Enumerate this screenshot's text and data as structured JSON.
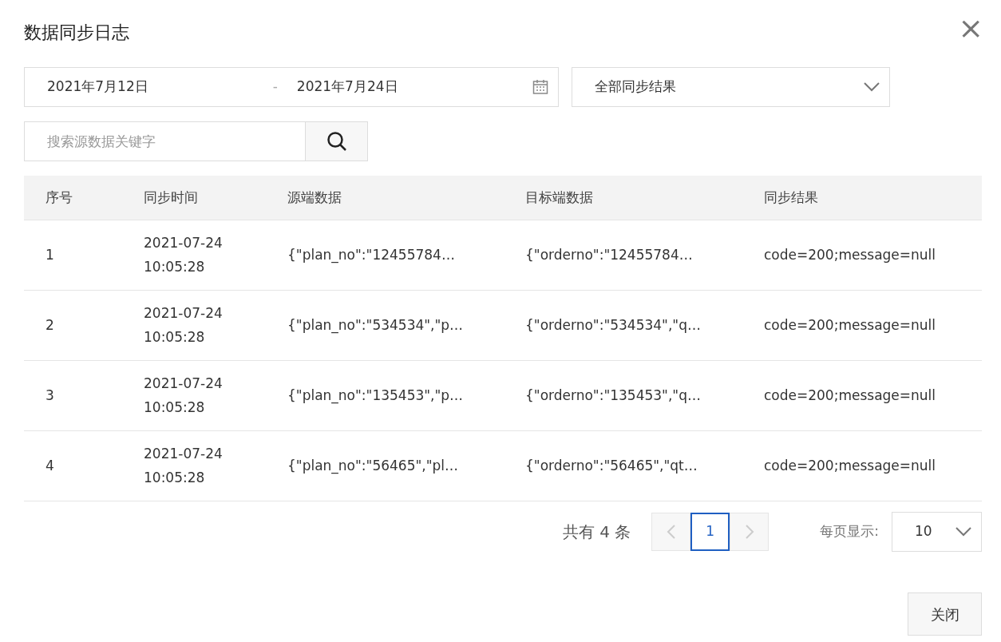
{
  "dialog": {
    "title": "数据同步日志",
    "close_icon": "×"
  },
  "filters": {
    "date_start": "2021年7月12日",
    "date_separator": "-",
    "date_end": "2021年7月24日",
    "result_select": "全部同步结果",
    "search": {
      "placeholder": "搜索源数据关键字"
    }
  },
  "table": {
    "columns": [
      "序号",
      "同步时间",
      "源端数据",
      "目标端数据",
      "同步结果"
    ],
    "rows": [
      {
        "cells": [
          "1",
          "2021-07-24\n10:05:28",
          "{\"plan_no\":\"12455784…",
          "{\"orderno\":\"12455784…",
          "code=200;message=null"
        ]
      },
      {
        "cells": [
          "2",
          "2021-07-24\n10:05:28",
          "{\"plan_no\":\"534534\",\"p…",
          "{\"orderno\":\"534534\",\"q…",
          "code=200;message=null"
        ]
      },
      {
        "cells": [
          "3",
          "2021-07-24\n10:05:28",
          "{\"plan_no\":\"135453\",\"p…",
          "{\"orderno\":\"135453\",\"q…",
          "code=200;message=null"
        ]
      },
      {
        "cells": [
          "4",
          "2021-07-24\n10:05:28",
          "{\"plan_no\":\"56465\",\"pl…",
          "{\"orderno\":\"56465\",\"qt…",
          "code=200;message=null"
        ]
      }
    ]
  },
  "pagination": {
    "total": "共有 4 条",
    "prev_disabled": true,
    "next_disabled": true,
    "pages": [
      {
        "label": "1",
        "selected": true
      }
    ],
    "page_size_label": "每页显示:",
    "page_size": "10"
  },
  "buttons": [
    "关闭"
  ]
}
